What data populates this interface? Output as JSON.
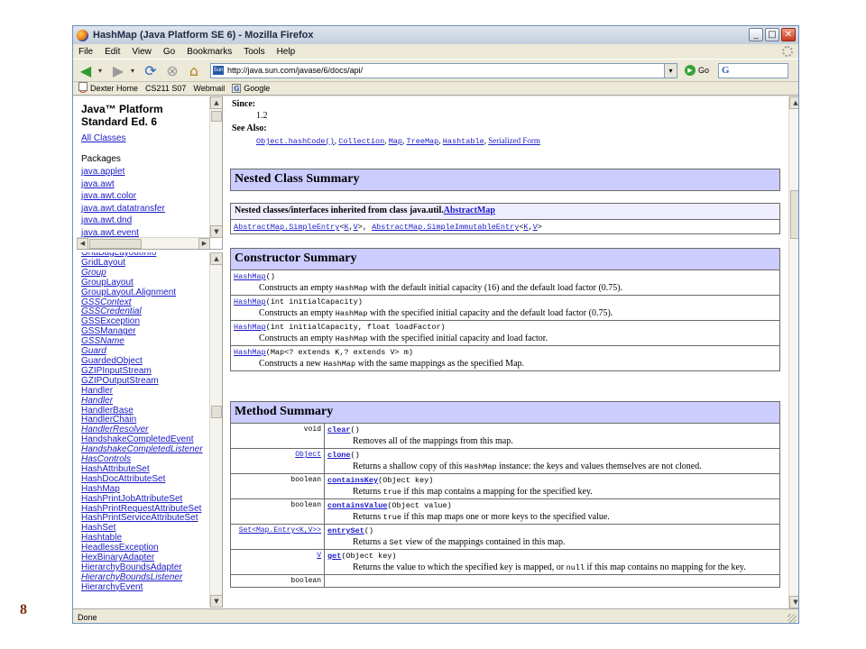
{
  "slide_number": "8",
  "window": {
    "title": "HashMap (Java Platform SE 6) - Mozilla Firefox",
    "buttons": {
      "minimize": "_",
      "maximize": "□",
      "close": "✕"
    }
  },
  "menu": [
    "File",
    "Edit",
    "View",
    "Go",
    "Bookmarks",
    "Tools",
    "Help"
  ],
  "address": {
    "url": "http://java.sun.com/javase/6/docs/api/",
    "favicon": "Sun",
    "go_label": "Go",
    "search_logo": "G"
  },
  "bookmarks": [
    {
      "label": "Dexter Home",
      "icon": "circle-icon"
    },
    {
      "label": "CS211 S07",
      "icon": "page-icon"
    },
    {
      "label": "Webmail",
      "icon": "page-icon"
    },
    {
      "label": "Google",
      "icon": "google-icon"
    }
  ],
  "packages_frame": {
    "heading_line1": "Java™ Platform",
    "heading_line2": "Standard Ed. 6",
    "all_classes": "All Classes",
    "packages_label": "Packages",
    "packages": [
      "java.applet",
      "java.awt",
      "java.awt.color",
      "java.awt.datatransfer",
      "java.awt.dnd",
      "java.awt.event"
    ]
  },
  "classes_frame": {
    "classes": [
      {
        "name": "GridBagLayoutInfo",
        "italic": false
      },
      {
        "name": "GridLayout",
        "italic": false
      },
      {
        "name": "Group",
        "italic": true
      },
      {
        "name": "GroupLayout",
        "italic": false
      },
      {
        "name": "GroupLayout.Alignment",
        "italic": false
      },
      {
        "name": "GSSContext",
        "italic": true
      },
      {
        "name": "GSSCredential",
        "italic": true
      },
      {
        "name": "GSSException",
        "italic": false
      },
      {
        "name": "GSSManager",
        "italic": false
      },
      {
        "name": "GSSName",
        "italic": true
      },
      {
        "name": "Guard",
        "italic": true
      },
      {
        "name": "GuardedObject",
        "italic": false
      },
      {
        "name": "GZIPInputStream",
        "italic": false
      },
      {
        "name": "GZIPOutputStream",
        "italic": false
      },
      {
        "name": "Handler",
        "italic": false
      },
      {
        "name": "Handler",
        "italic": true
      },
      {
        "name": "HandlerBase",
        "italic": false
      },
      {
        "name": "HandlerChain",
        "italic": false
      },
      {
        "name": "HandlerResolver",
        "italic": true
      },
      {
        "name": "HandshakeCompletedEvent",
        "italic": false
      },
      {
        "name": "HandshakeCompletedListener",
        "italic": true
      },
      {
        "name": "HasControls",
        "italic": true
      },
      {
        "name": "HashAttributeSet",
        "italic": false
      },
      {
        "name": "HashDocAttributeSet",
        "italic": false
      },
      {
        "name": "HashMap",
        "italic": false
      },
      {
        "name": "HashPrintJobAttributeSet",
        "italic": false
      },
      {
        "name": "HashPrintRequestAttributeSet",
        "italic": false
      },
      {
        "name": "HashPrintServiceAttributeSet",
        "italic": false
      },
      {
        "name": "HashSet",
        "italic": false
      },
      {
        "name": "Hashtable",
        "italic": false
      },
      {
        "name": "HeadlessException",
        "italic": false
      },
      {
        "name": "HexBinaryAdapter",
        "italic": false
      },
      {
        "name": "HierarchyBoundsAdapter",
        "italic": false
      },
      {
        "name": "HierarchyBoundsListener",
        "italic": true
      },
      {
        "name": "HierarchyEvent",
        "italic": false
      }
    ]
  },
  "doc": {
    "since_label": "Since:",
    "since_value": "1.2",
    "see_also_label": "See Also:",
    "see_also": [
      {
        "text": "Object.hashCode()",
        "mono": true
      },
      {
        "text": "Collection",
        "mono": true
      },
      {
        "text": "Map",
        "mono": true
      },
      {
        "text": "TreeMap",
        "mono": true
      },
      {
        "text": "Hashtable",
        "mono": true
      },
      {
        "text": "Serialized Form",
        "mono": false
      }
    ],
    "nested": {
      "title": "Nested Class Summary",
      "inherited_prefix": "Nested classes/interfaces inherited from class java.util.",
      "inherited_class": "AbstractMap",
      "entry1": "AbstractMap.SimpleEntry",
      "entry2": "AbstractMap.SimpleImmutableEntry"
    },
    "constructors": {
      "title": "Constructor Summary",
      "rows": [
        {
          "name": "HashMap",
          "params": "()",
          "desc_pre": "Constructs an empty ",
          "desc_code": "HashMap",
          "desc_post": " with the default initial capacity (16) and the default load factor (0.75)."
        },
        {
          "name": "HashMap",
          "params": "(int initialCapacity)",
          "desc_pre": "Constructs an empty ",
          "desc_code": "HashMap",
          "desc_post": " with the specified initial capacity and the default load factor (0.75)."
        },
        {
          "name": "HashMap",
          "params": "(int initialCapacity, float loadFactor)",
          "desc_pre": "Constructs an empty ",
          "desc_code": "HashMap",
          "desc_post": " with the specified initial capacity and load factor."
        },
        {
          "name": "HashMap",
          "params": "(Map<? extends K,? extends V> m)",
          "desc_pre": "Constructs a new ",
          "desc_code": "HashMap",
          "desc_post": " with the same mappings as the specified Map."
        }
      ]
    },
    "methods": {
      "title": "Method Summary",
      "rows": [
        {
          "type": "void",
          "type_link": false,
          "name": "clear",
          "params": "()",
          "desc_pre": "Removes all of the mappings from this map.",
          "desc_code": "",
          "desc_post": ""
        },
        {
          "type": "Object",
          "type_link": true,
          "name": "clone",
          "params": "()",
          "desc_pre": "Returns a shallow copy of this ",
          "desc_code": "HashMap",
          "desc_post": " instance: the keys and values themselves are not cloned."
        },
        {
          "type": "boolean",
          "type_link": false,
          "name": "containsKey",
          "params": "(Object key)",
          "desc_pre": "Returns ",
          "desc_code": "true",
          "desc_post": " if this map contains a mapping for the specified key."
        },
        {
          "type": "boolean",
          "type_link": false,
          "name": "containsValue",
          "params": "(Object value)",
          "desc_pre": "Returns ",
          "desc_code": "true",
          "desc_post": " if this map maps one or more keys to the specified value."
        },
        {
          "type": "Set<Map.Entry<K,V>>",
          "type_link": true,
          "name": "entrySet",
          "params": "()",
          "desc_pre": "Returns a ",
          "desc_code": "Set",
          "desc_post": " view of the mappings contained in this map."
        },
        {
          "type": "V",
          "type_link": true,
          "name": "get",
          "params": "(Object key)",
          "desc_pre": "Returns the value to which the specified key is mapped, or ",
          "desc_code": "null",
          "desc_post": " if this map contains no mapping for the key."
        },
        {
          "type": "boolean",
          "type_link": false,
          "name": "",
          "params": "",
          "desc_pre": "",
          "desc_code": "",
          "desc_post": ""
        }
      ]
    }
  },
  "status": "Done"
}
